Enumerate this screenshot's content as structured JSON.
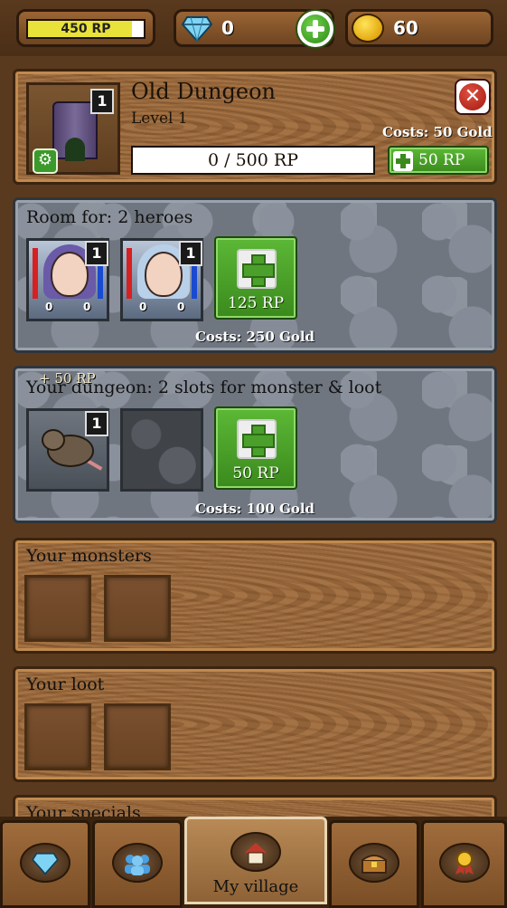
{
  "topbar": {
    "rp_text": "450 RP",
    "rp_progress": 0.9,
    "gems": "0",
    "gold": "60"
  },
  "dungeon": {
    "name": "Old Dungeon",
    "level": "Level 1",
    "badge": "1",
    "upgrade_costs": "Costs: 50 Gold",
    "rp_progress_text": "0 / 500 RP",
    "buy_rp_label": "50 RP"
  },
  "heroes": {
    "title": "Room for: 2 heroes",
    "items": [
      {
        "level": "1",
        "potion_red": "0",
        "potion_blue": "0",
        "hair": "#6a5aa8"
      },
      {
        "level": "1",
        "potion_red": "0",
        "potion_blue": "0",
        "hair": "#b8d0e8"
      }
    ],
    "add_label": "125 RP",
    "costs": "Costs: 250 Gold"
  },
  "slots": {
    "float_text": "+ 50 RP",
    "title": "Your dungeon: 2 slots for monster & loot",
    "monster_level": "1",
    "add_label": "50 RP",
    "costs": "Costs: 100 Gold"
  },
  "monsters": {
    "title": "Your monsters"
  },
  "loot": {
    "title": "Your loot"
  },
  "specials": {
    "title": "Your specials"
  },
  "nav": {
    "tabs": [
      {
        "icon": "gem-icon",
        "label": ""
      },
      {
        "icon": "heroes-icon",
        "label": ""
      },
      {
        "icon": "village-icon",
        "label": "My village"
      },
      {
        "icon": "chest-icon",
        "label": ""
      },
      {
        "icon": "medal-icon",
        "label": ""
      }
    ]
  },
  "colors": {
    "accent_green": "#3a8a1c",
    "rp_bar": "#e8e23a",
    "wood": "#8e5e33",
    "stone": "#6f7680"
  }
}
